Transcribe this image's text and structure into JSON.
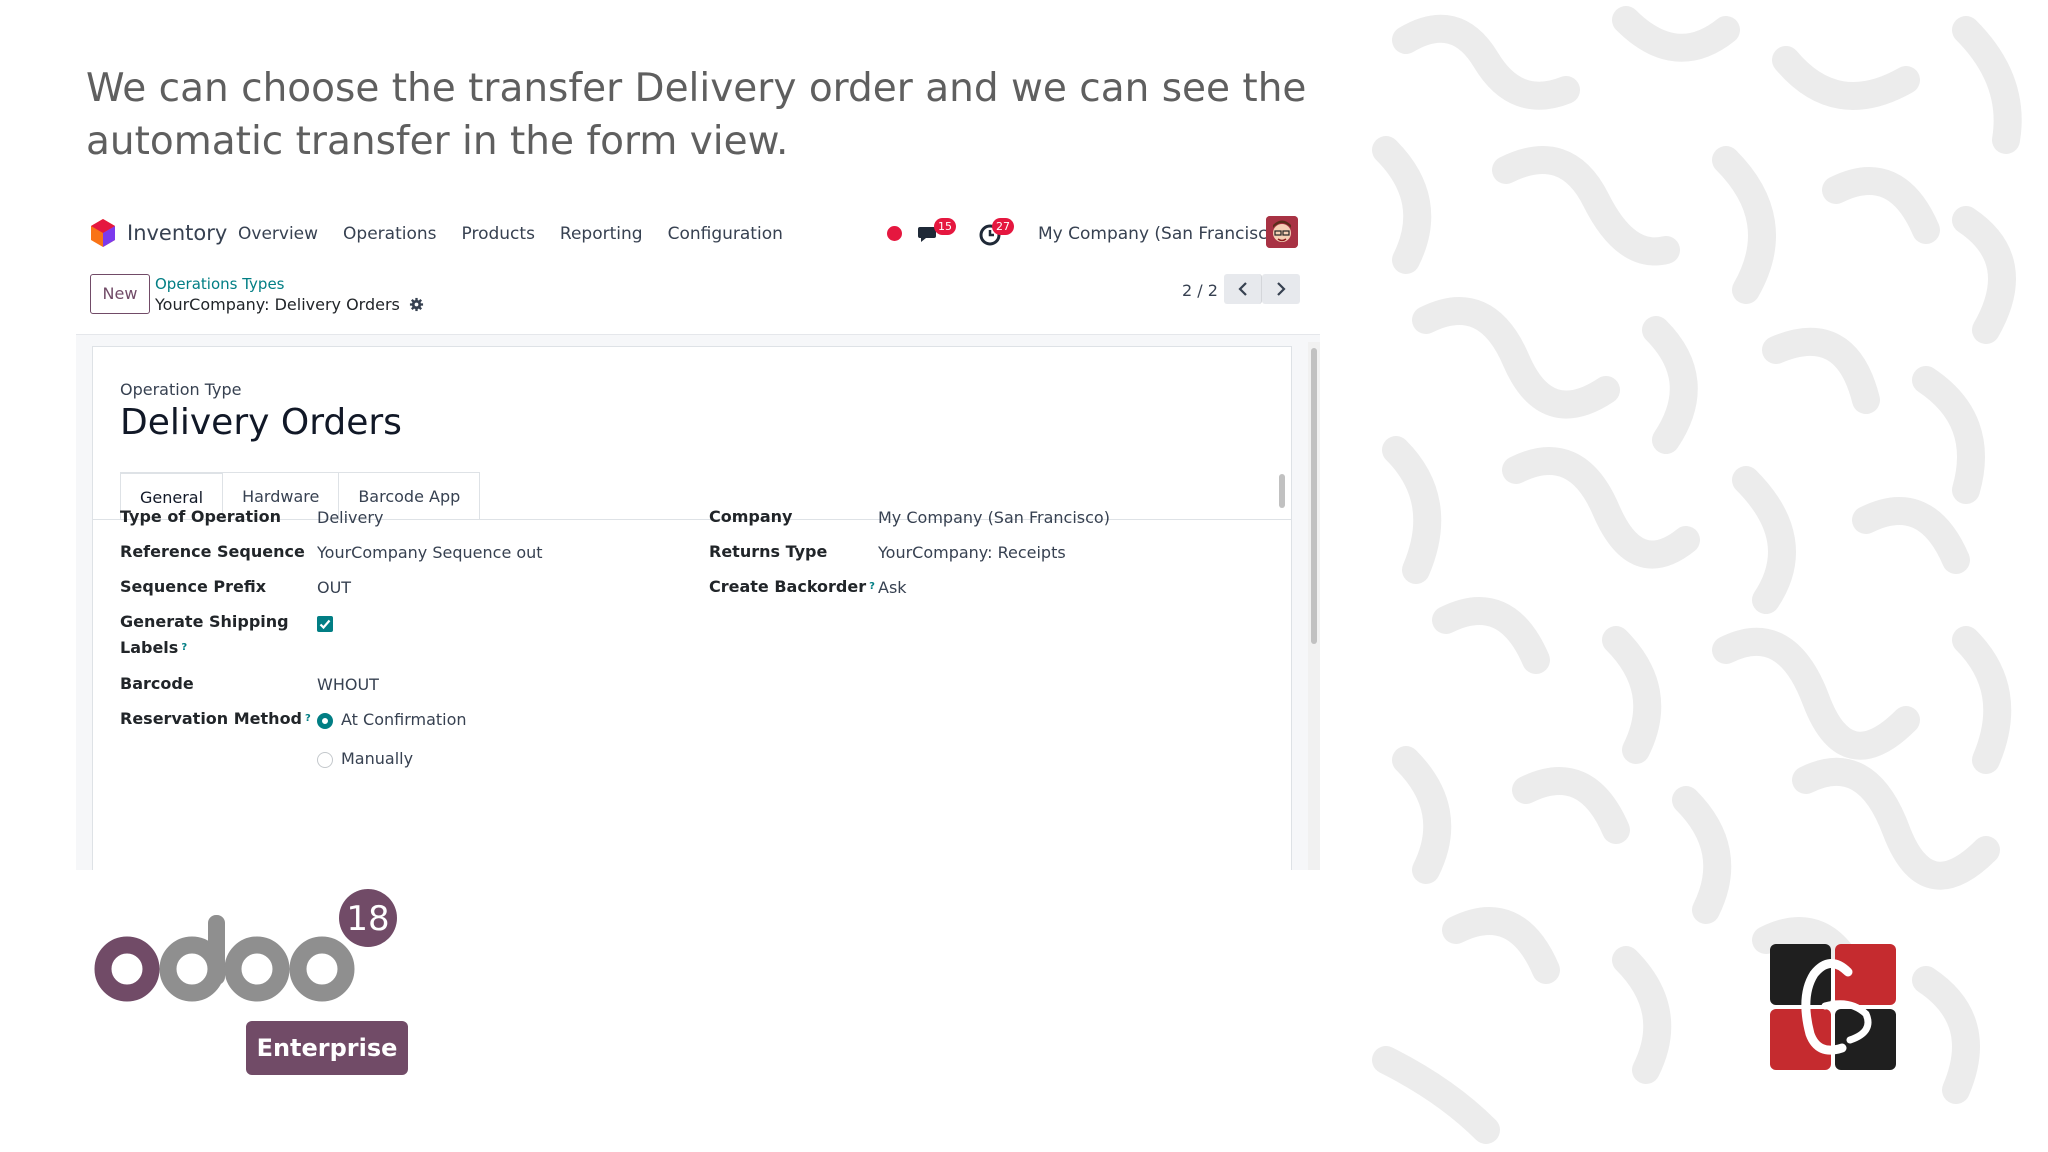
{
  "slide": {
    "caption": "We can choose the transfer Delivery order and we can see the automatic transfer in the form view."
  },
  "navbar": {
    "app_name": "Inventory",
    "menu": [
      "Overview",
      "Operations",
      "Products",
      "Reporting",
      "Configuration"
    ],
    "messages_count": "15",
    "activities_count": "27",
    "company": "My Company (San Francisco)"
  },
  "control_panel": {
    "new_label": "New",
    "breadcrumb_parent": "Operations Types",
    "breadcrumb_current": "YourCompany: Delivery Orders",
    "pager": "2 / 2"
  },
  "form": {
    "type_label": "Operation Type",
    "title": "Delivery Orders",
    "tabs": [
      "General",
      "Hardware",
      "Barcode App"
    ],
    "active_tab": "General",
    "left_fields": [
      {
        "label": "Type of Operation",
        "value": "Delivery"
      },
      {
        "label": "Reference Sequence",
        "value": "YourCompany Sequence out"
      },
      {
        "label": "Sequence Prefix",
        "value": "OUT"
      },
      {
        "label_line1": "Generate Shipping",
        "label_line2": "Labels",
        "checked": true
      },
      {
        "label": "Barcode",
        "value": "WHOUT"
      },
      {
        "label": "Reservation Method",
        "options": [
          "At Confirmation",
          "Manually"
        ],
        "selected": "At Confirmation"
      }
    ],
    "right_fields": [
      {
        "label": "Company",
        "value": "My Company (San Francisco)"
      },
      {
        "label": "Returns Type",
        "value": "YourCompany: Receipts"
      },
      {
        "label": "Create Backorder",
        "value": "Ask"
      }
    ],
    "tooltip_mark": "?"
  },
  "branding": {
    "version": "18",
    "edition": "Enterprise",
    "logo_text": "odoo"
  },
  "colors": {
    "odoo_purple": "#714b67",
    "odoo_teal": "#017e84",
    "badge_red": "#e5173f",
    "caption_gray": "#5f5f5f"
  }
}
